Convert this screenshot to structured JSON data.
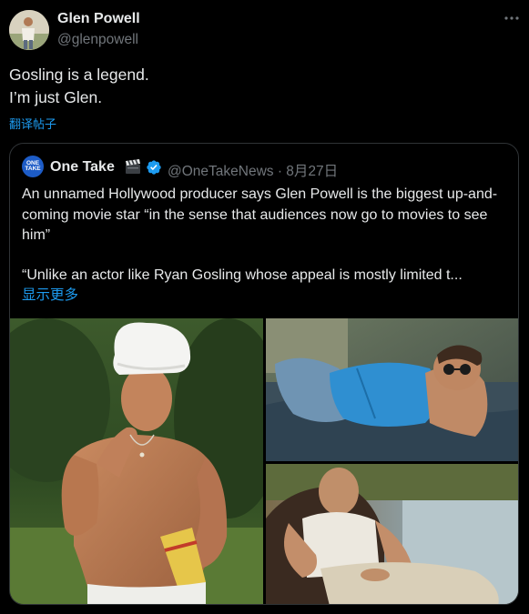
{
  "tweet": {
    "author_name": "Glen Powell",
    "author_handle": "@glenpowell",
    "more_icon": "more-dots-icon",
    "text": "Gosling is a legend.\nI’m just Glen.",
    "translate_label": "翻译帖子"
  },
  "quote": {
    "avatar_text": "ONE TAKE",
    "name": "One Take",
    "emoji_icon": "clapper-board-icon",
    "verified_icon": "verified-badge-icon",
    "handle_date": "@OneTakeNews · 8月27日",
    "paragraph1": "An unnamed Hollywood producer says Glen Powell is the biggest up-and-coming movie star “in the sense that audiences now go to movies to see him”",
    "paragraph2": "“Unlike an actor like Ryan Gosling whose appeal is mostly limited t...",
    "show_more": "显示更多"
  },
  "colors": {
    "background": "#000000",
    "text": "#e7e9ea",
    "secondary": "#71767b",
    "link": "#1d9bf0",
    "border": "#2f3336"
  }
}
